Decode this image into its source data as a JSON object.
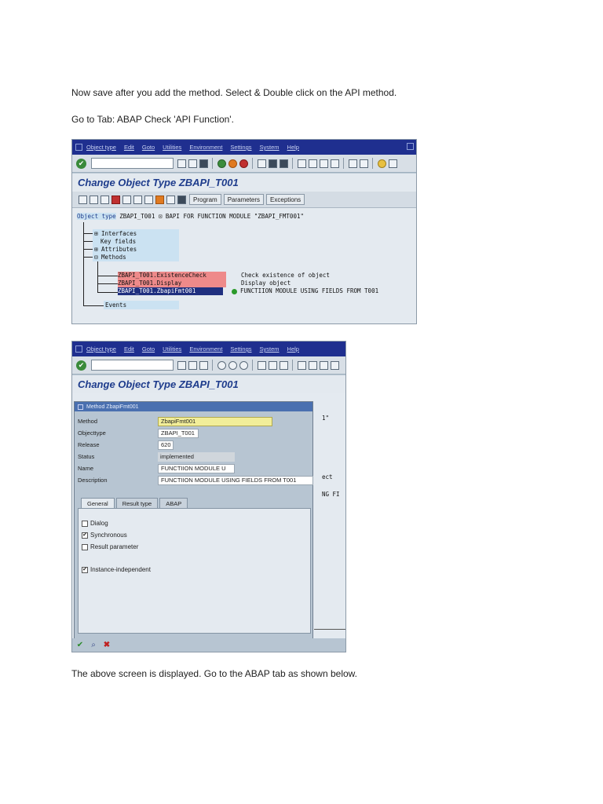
{
  "doc": {
    "para1": "Now save after you add the method. Select & Double click on the API method.",
    "para2": "Go to Tab: ABAP Check 'API Function'.",
    "para3": "The above screen is displayed. Go to the ABAP tab as shown below."
  },
  "menu": {
    "items": [
      "Object type",
      "Edit",
      "Goto",
      "Utilities",
      "Environment",
      "Settings",
      "System",
      "Help"
    ]
  },
  "screen1": {
    "title": "Change Object Type ZBAPI_T001",
    "buttons": [
      "Program",
      "Parameters",
      "Exceptions"
    ],
    "object_label": "Object type",
    "object_line": "ZBAPI_T001 ⊡ BAPI  FOR  FUNCTION MODULE  \"ZBAPI_FMT001\"",
    "tree": {
      "interfaces": "Interfaces",
      "key_fields": "Key fields",
      "attributes": "Attributes",
      "methods": "Methods",
      "events": "Events"
    },
    "methods": [
      {
        "name": "ZBAPI_T001.ExistenceCheck",
        "desc": "Check existence of object"
      },
      {
        "name": "ZBAPI_T001.Display",
        "desc": "Display object"
      },
      {
        "name": "ZBAPI_T001.ZbapiFmt001",
        "desc": "FUNCTIION  MODULE  USING  FIELDS  FROM  T001"
      }
    ]
  },
  "screen2": {
    "title": "Change Object Type ZBAPI_T001",
    "bg_fragments": [
      "1\"",
      "ect",
      "NG  FI"
    ],
    "dialog": {
      "title": "Method ZbapiFmt001",
      "fields": [
        {
          "label": "Method",
          "value": "ZbapiFmt001"
        },
        {
          "label": "Objecttype",
          "value": "ZBAPI_T001"
        },
        {
          "label": "Release",
          "value": "620"
        },
        {
          "label": "Status",
          "value": "implemented"
        },
        {
          "label": "Name",
          "value": "FUNCTIION  MODULE  U"
        },
        {
          "label": "Description",
          "value": "FUNCTIION MODULE USING FIELDS FROM T001"
        }
      ],
      "tabs": [
        "General",
        "Result type",
        "ABAP"
      ],
      "checkboxes": [
        {
          "label": "Dialog",
          "mark": ""
        },
        {
          "label": "Synchronous",
          "mark": "✔"
        },
        {
          "label": "Result parameter",
          "mark": ""
        },
        {
          "label": "Instance-independent",
          "mark": "✔"
        }
      ]
    }
  },
  "colors": {
    "menubar": "#1f2f8f",
    "title_text": "#1e3c8c",
    "method_highlight": "#ee8a8a",
    "selected": "#1f2f7f"
  }
}
